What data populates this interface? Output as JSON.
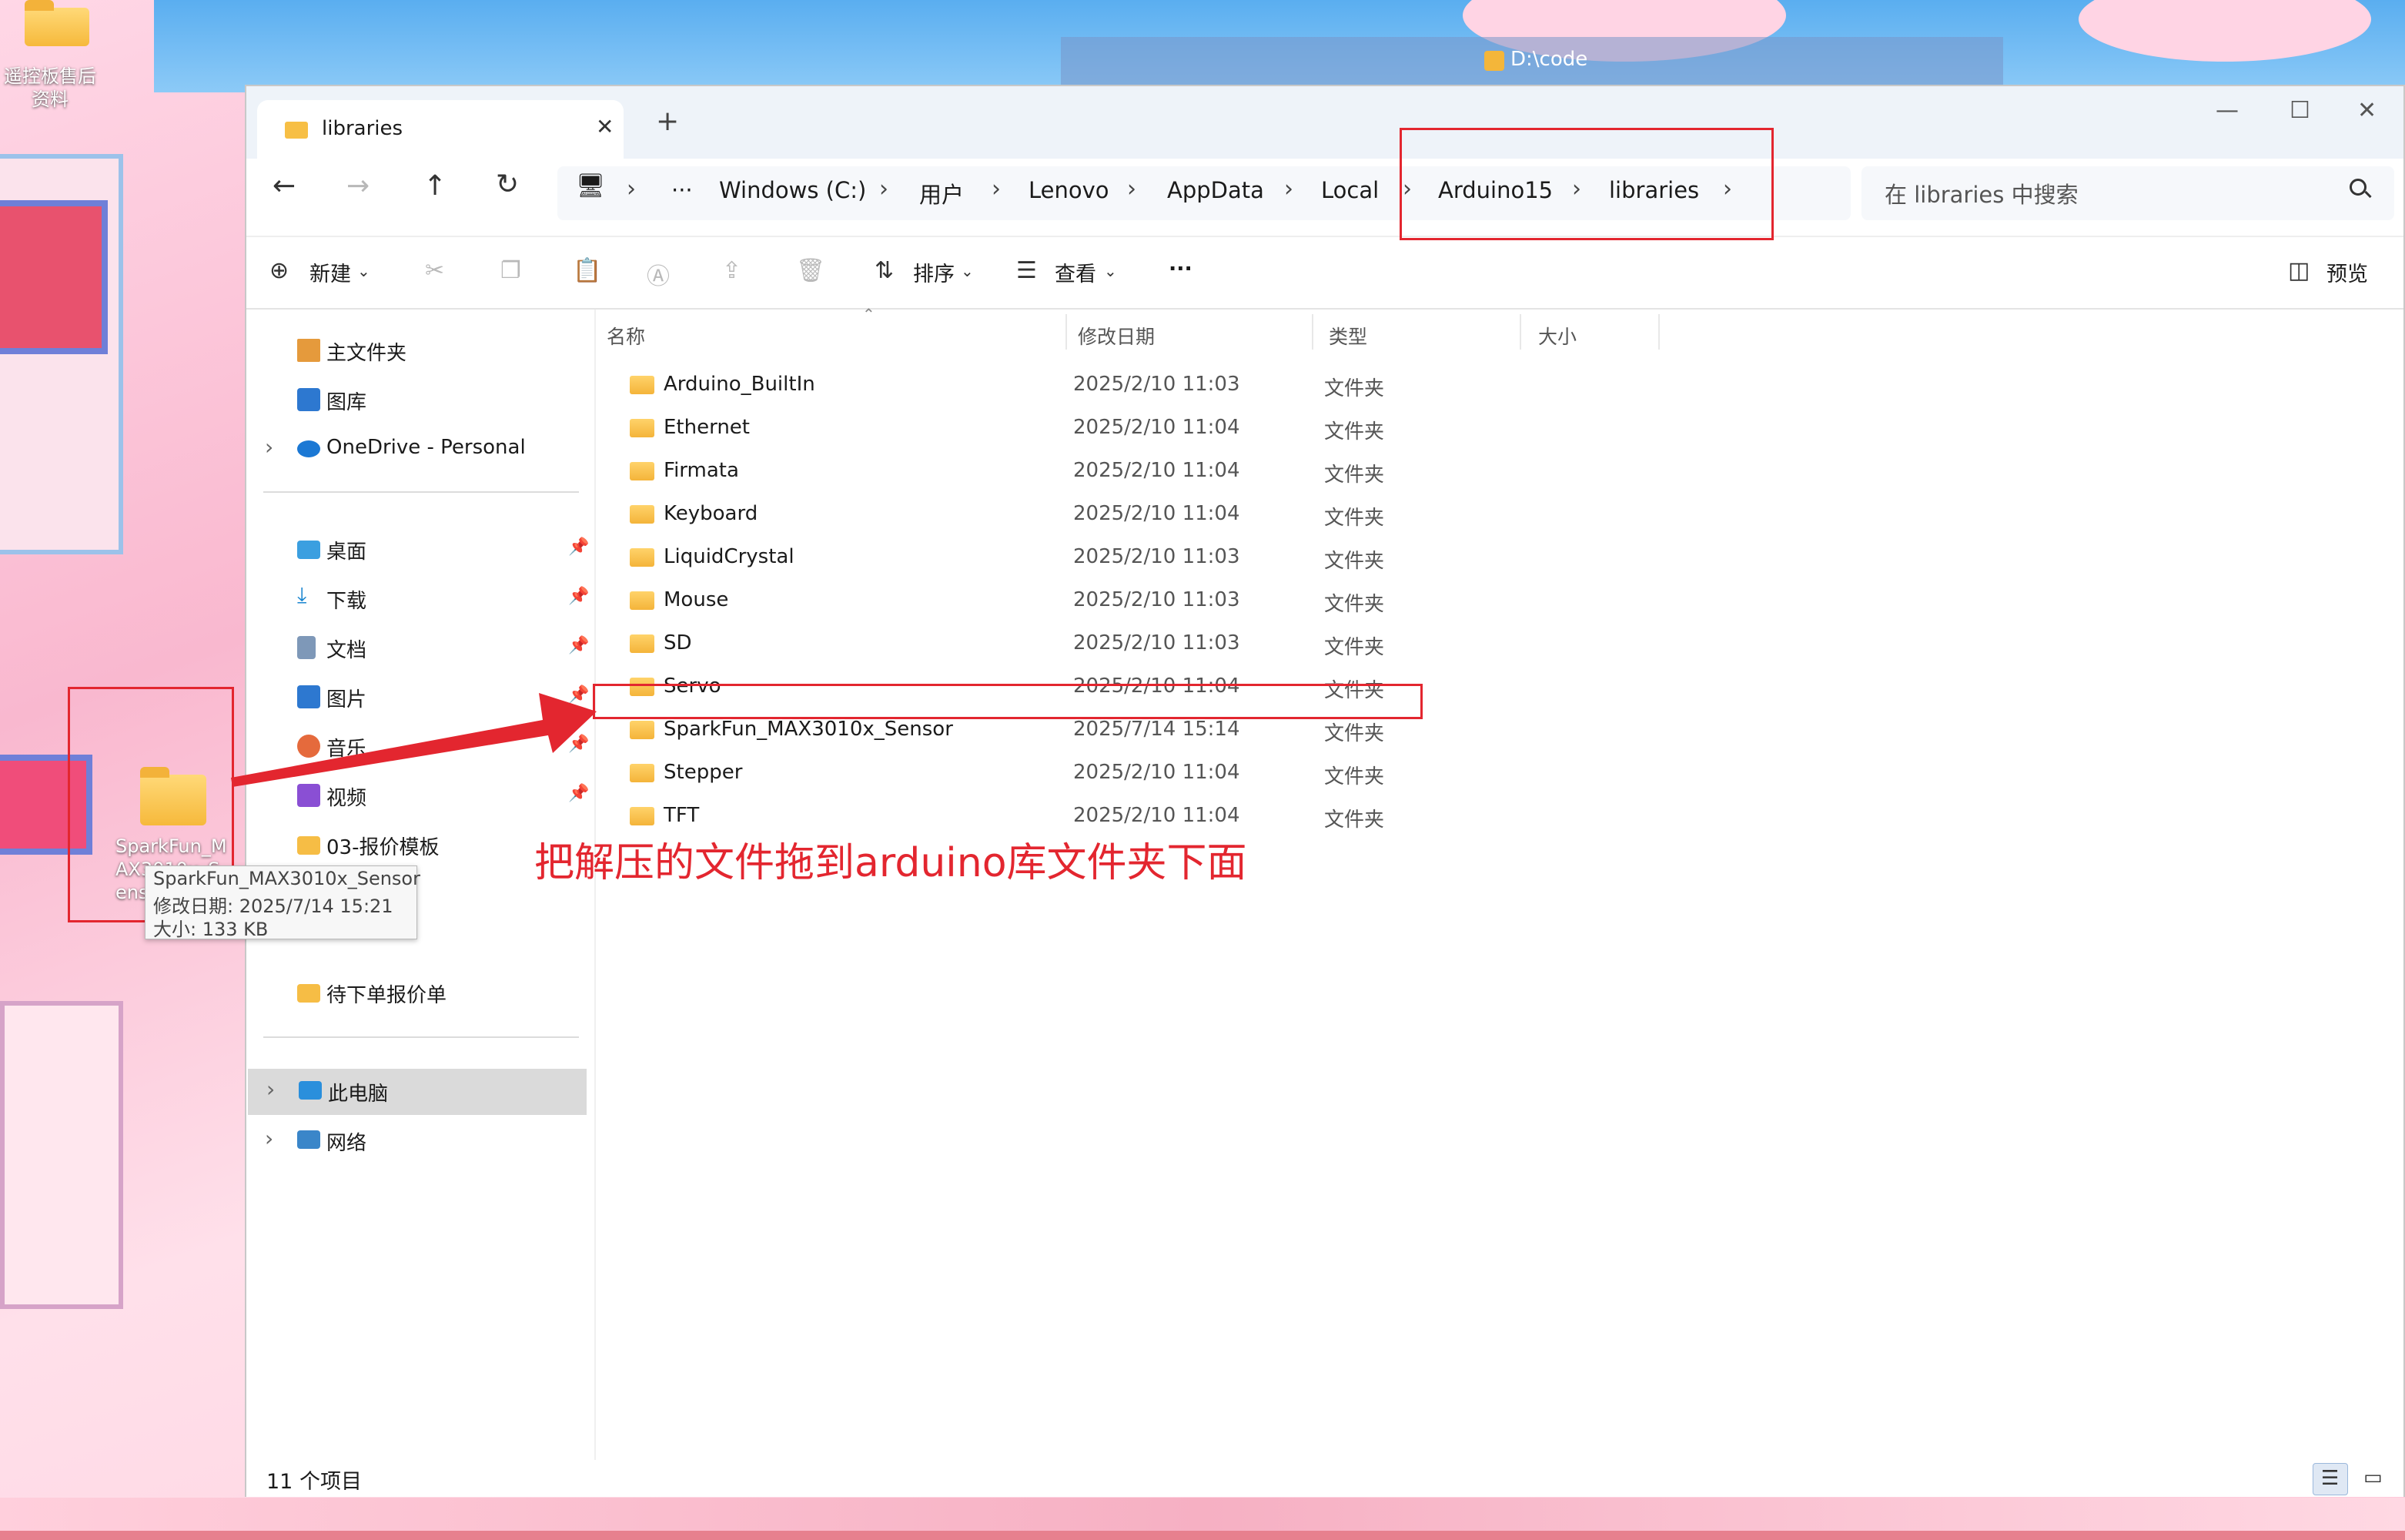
{
  "desktop": {
    "top_left_icon_label": "遥控板售后资料",
    "dragged_icon_label": "SparkFun_MAX3010x_Sensor",
    "top_window_title": "D:\\code",
    "drag_tooltip": {
      "name": "SparkFun_MAX3010x_Sensor",
      "modified": "修改日期: 2025/7/14 15:21",
      "size": "大小: 133 KB"
    }
  },
  "window": {
    "tab_title": "libraries",
    "tab_close": "✕",
    "tab_new": "+",
    "controls": {
      "minimize": "—",
      "maximize": "☐",
      "close": "✕"
    }
  },
  "nav": {
    "back": "←",
    "forward": "→",
    "up": "↑",
    "refresh": "↻"
  },
  "breadcrumb": {
    "more": "···",
    "items": [
      "Windows (C:)",
      "用户",
      "Lenovo",
      "AppData",
      "Local",
      "Arduino15",
      "libraries"
    ]
  },
  "search": {
    "placeholder": "在 libraries 中搜索"
  },
  "toolbar": {
    "new_label": "新建",
    "sort_label": "排序",
    "view_label": "查看",
    "more_label": "···",
    "preview_label": "预览"
  },
  "sidebar": {
    "top": [
      "主文件夹",
      "图库",
      "OneDrive - Personal"
    ],
    "quick": [
      "桌面",
      "下载",
      "文档",
      "图片",
      "音乐",
      "视频",
      "03-报价模板",
      "待下单报价单"
    ],
    "bottom": [
      "此电脑",
      "网络"
    ]
  },
  "columns": {
    "name": "名称",
    "date": "修改日期",
    "type": "类型",
    "size": "大小"
  },
  "files": [
    {
      "name": "Arduino_BuiltIn",
      "date": "2025/2/10 11:03",
      "type": "文件夹"
    },
    {
      "name": "Ethernet",
      "date": "2025/2/10 11:04",
      "type": "文件夹"
    },
    {
      "name": "Firmata",
      "date": "2025/2/10 11:04",
      "type": "文件夹"
    },
    {
      "name": "Keyboard",
      "date": "2025/2/10 11:04",
      "type": "文件夹"
    },
    {
      "name": "LiquidCrystal",
      "date": "2025/2/10 11:03",
      "type": "文件夹"
    },
    {
      "name": "Mouse",
      "date": "2025/2/10 11:03",
      "type": "文件夹"
    },
    {
      "name": "SD",
      "date": "2025/2/10 11:03",
      "type": "文件夹"
    },
    {
      "name": "Servo",
      "date": "2025/2/10 11:04",
      "type": "文件夹"
    },
    {
      "name": "SparkFun_MAX3010x_Sensor",
      "date": "2025/7/14 15:14",
      "type": "文件夹"
    },
    {
      "name": "Stepper",
      "date": "2025/2/10 11:04",
      "type": "文件夹"
    },
    {
      "name": "TFT",
      "date": "2025/2/10 11:04",
      "type": "文件夹"
    }
  ],
  "status": {
    "count": "11 个项目"
  },
  "annotation": {
    "text": "把解压的文件拖到arduino库文件夹下面",
    "color": "#e3262f"
  }
}
